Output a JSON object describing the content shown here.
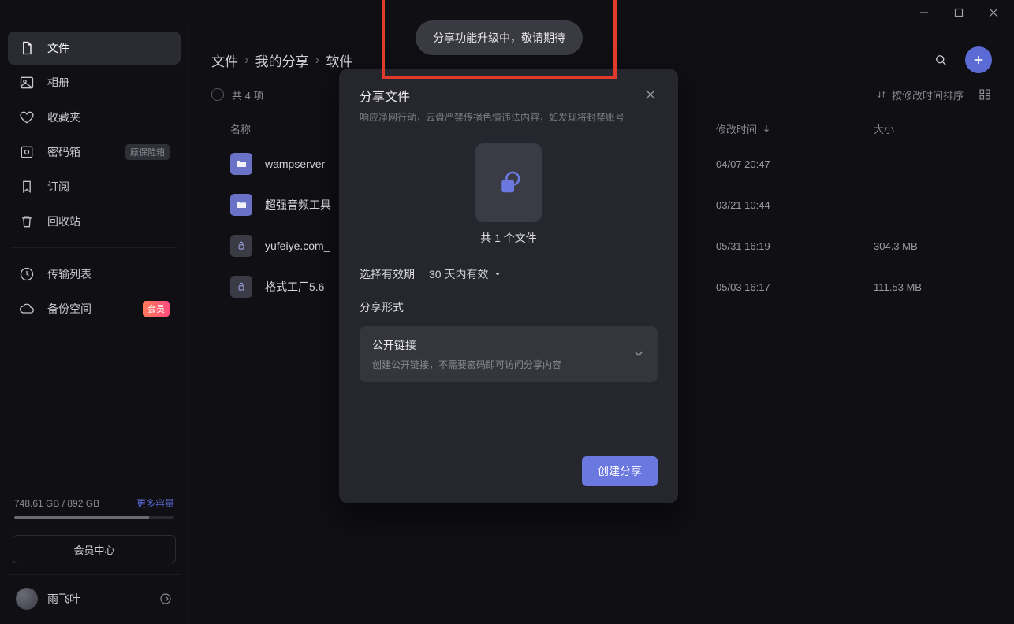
{
  "window": {
    "minimize": "—",
    "maximize": "□",
    "close": "✕"
  },
  "sidebar": {
    "items": [
      {
        "label": "文件",
        "badge": ""
      },
      {
        "label": "相册",
        "badge": ""
      },
      {
        "label": "收藏夹",
        "badge": ""
      },
      {
        "label": "密码箱",
        "badge": "原保险箱"
      },
      {
        "label": "订阅",
        "badge": ""
      },
      {
        "label": "回收站",
        "badge": ""
      }
    ],
    "items2": [
      {
        "label": "传输列表",
        "badge": ""
      },
      {
        "label": "备份空间",
        "badge": "会员"
      }
    ],
    "storage_text": "748.61 GB / 892 GB",
    "storage_more": "更多容量",
    "member_center": "会员中心",
    "username": "雨飞叶"
  },
  "breadcrumb": {
    "a": "文件",
    "b": "我的分享",
    "c": "软件"
  },
  "meta": {
    "count_label": "共 4 项",
    "sort_label": "按修改时间排序"
  },
  "columns": {
    "name": "名称",
    "time": "修改时间",
    "size": "大小"
  },
  "files": [
    {
      "name": "wampserver",
      "time": "04/07 20:47",
      "size": "",
      "type": "folder"
    },
    {
      "name": "超强音频工具",
      "time": "03/21 10:44",
      "size": "",
      "type": "folder"
    },
    {
      "name": "yufeiye.com_",
      "time": "05/31 16:19",
      "size": "304.3 MB",
      "type": "file"
    },
    {
      "name": "格式工厂5.6",
      "time": "05/03 16:17",
      "size": "111.53 MB",
      "type": "file"
    }
  ],
  "toast": {
    "text": "分享功能升级中，敬请期待"
  },
  "dialog": {
    "title": "分享文件",
    "subtitle": "响应净网行动，云盘严禁传播色情违法内容，如发现将封禁账号",
    "file_count": "共 1 个文件",
    "validity_label": "选择有效期",
    "validity_value": "30 天内有效",
    "share_form_label": "分享形式",
    "option_title": "公开链接",
    "option_desc": "创建公开链接，不需要密码即可访问分享内容",
    "submit": "创建分享"
  }
}
